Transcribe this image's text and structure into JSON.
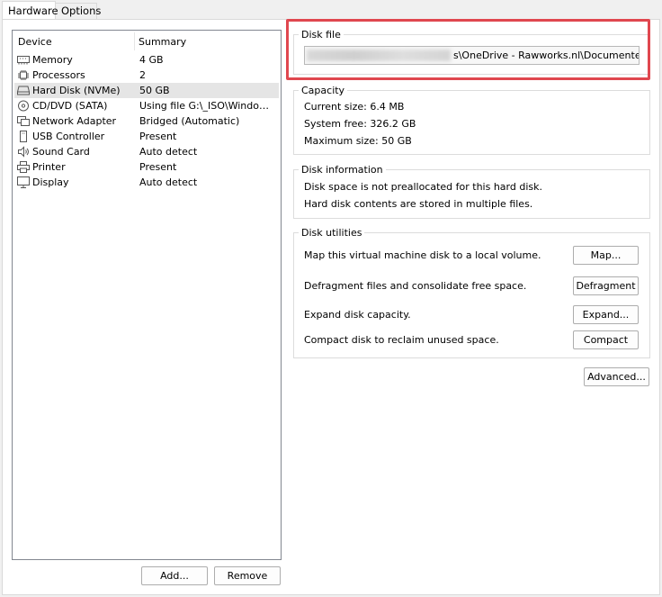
{
  "tabs": {
    "hardware": "Hardware",
    "options": "Options"
  },
  "devices": {
    "header_device": "Device",
    "header_summary": "Summary",
    "items": [
      {
        "icon": "memory-icon",
        "name": "Memory",
        "summary": "4 GB"
      },
      {
        "icon": "processor-icon",
        "name": "Processors",
        "summary": "2"
      },
      {
        "icon": "hard-disk-icon",
        "name": "Hard Disk (NVMe)",
        "summary": "50 GB",
        "selected": true
      },
      {
        "icon": "cd-dvd-icon",
        "name": "CD/DVD (SATA)",
        "summary": "Using file G:\\_ISO\\Windows ..."
      },
      {
        "icon": "network-adapter-icon",
        "name": "Network Adapter",
        "summary": "Bridged (Automatic)"
      },
      {
        "icon": "usb-icon",
        "name": "USB Controller",
        "summary": "Present"
      },
      {
        "icon": "sound-card-icon",
        "name": "Sound Card",
        "summary": "Auto detect"
      },
      {
        "icon": "printer-icon",
        "name": "Printer",
        "summary": "Present"
      },
      {
        "icon": "display-icon",
        "name": "Display",
        "summary": "Auto detect"
      }
    ],
    "add_button": "Add...",
    "remove_button": "Remove"
  },
  "disk_file": {
    "label": "Disk file",
    "path_visible": "s\\OneDrive - Rawworks.nl\\Documenten\\Virtu"
  },
  "capacity": {
    "label": "Capacity",
    "current_size": "Current size: 6.4 MB",
    "system_free": "System free: 326.2 GB",
    "maximum_size": "Maximum size: 50 GB"
  },
  "disk_information": {
    "label": "Disk information",
    "line1": "Disk space is not preallocated for this hard disk.",
    "line2": "Hard disk contents are stored in multiple files."
  },
  "disk_utilities": {
    "label": "Disk utilities",
    "map_text": "Map this virtual machine disk to a local volume.",
    "map_button": "Map...",
    "defrag_text": "Defragment files and consolidate free space.",
    "defrag_button": "Defragment",
    "expand_text": "Expand disk capacity.",
    "expand_button": "Expand...",
    "compact_text": "Compact disk to reclaim unused space.",
    "compact_button": "Compact"
  },
  "advanced_button": "Advanced...",
  "colors": {
    "highlight": "#e0474f",
    "selected_row": "#e5e5e5"
  }
}
